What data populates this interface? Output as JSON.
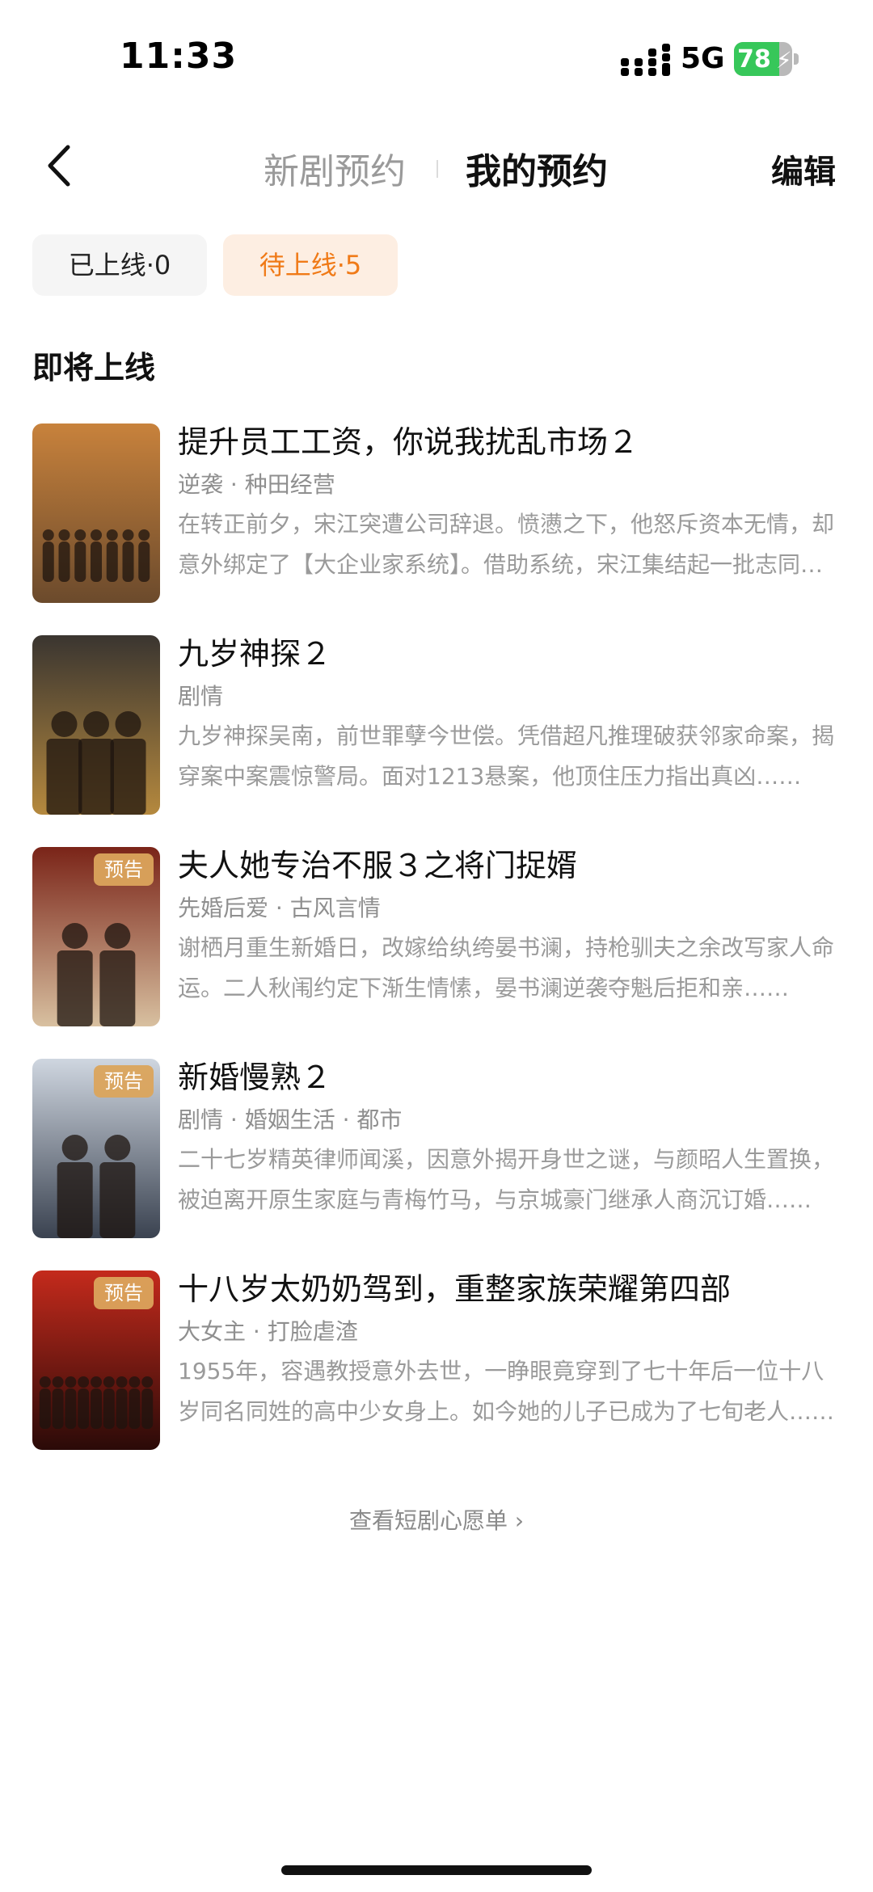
{
  "status_bar": {
    "time": "11:33",
    "network": "5G",
    "battery": "78",
    "battery_fraction": 0.78
  },
  "header": {
    "tab_new": "新剧预约",
    "tab_mine": "我的预约",
    "edit": "编辑"
  },
  "filters": {
    "online": "已上线·0",
    "pending": "待上线·5"
  },
  "section_title": "即将上线",
  "items": [
    {
      "title": "提升员工工资，你说我扰乱市场２",
      "tags": "逆袭 · 种田经营",
      "desc": "在转正前夕，宋江突遭公司辞退。愤懑之下，他怒斥资本无情，却意外绑定了【大企业家系统】。借助系统，宋江集结起一批志同道合的伙伴……",
      "badge": "",
      "poster_colors": [
        "#c8823c",
        "#6b4a2c"
      ]
    },
    {
      "title": "九岁神探２",
      "tags": "剧情",
      "desc": "九岁神探吴南，前世罪孽今世偿。凭借超凡推理破获邻家命案，揭穿案中案震惊警局。面对1213悬案，他顶住压力指出真凶……",
      "badge": "",
      "poster_colors": [
        "#3a3530",
        "#b5893e"
      ]
    },
    {
      "title": "夫人她专治不服３之将门捉婿",
      "tags": "先婚后爱 · 古风言情",
      "desc": "谢栖月重生新婚日，改嫁给纨绔晏书澜，持枪驯夫之余改写家人命运。二人秋闱约定下渐生情愫，晏书澜逆袭夺魁后拒和亲……",
      "badge": "预告",
      "poster_colors": [
        "#7a2418",
        "#d8c0a0"
      ]
    },
    {
      "title": "新婚慢熟２",
      "tags": "剧情 · 婚姻生活 · 都市",
      "desc": "二十七岁精英律师闻溪，因意外揭开身世之谜，与颜昭人生置换，被迫离开原生家庭与青梅竹马，与京城豪门继承人商沉订婚……",
      "badge": "预告",
      "poster_colors": [
        "#cfd6e0",
        "#3a4250"
      ]
    },
    {
      "title": "十八岁太奶奶驾到，重整家族荣耀第四部",
      "tags": "大女主 · 打脸虐渣",
      "desc": "1955年，容遇教授意外去世，一睁眼竟穿到了七十年后一位十八岁同名同姓的高中少女身上。如今她的儿子已成为了七旬老人……",
      "badge": "预告",
      "poster_colors": [
        "#c42a1c",
        "#2a0a08"
      ]
    }
  ],
  "wishlist_link": "查看短剧心愿单 ›"
}
